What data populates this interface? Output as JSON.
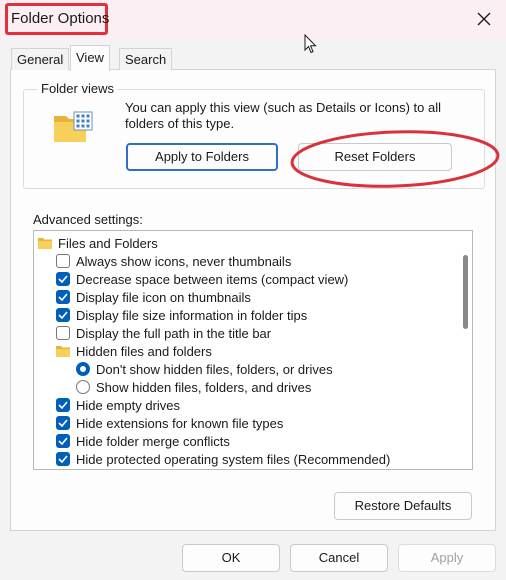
{
  "window": {
    "title": "Folder Options"
  },
  "tabs": [
    {
      "label": "General",
      "active": false
    },
    {
      "label": "View",
      "active": true
    },
    {
      "label": "Search",
      "active": false
    }
  ],
  "folder_views": {
    "heading": "Folder views",
    "description": "You can apply this view (such as Details or Icons) to all folders of this type.",
    "apply_button_label": "Apply to Folders",
    "reset_button_label": "Reset Folders"
  },
  "advanced": {
    "label": "Advanced settings:",
    "items": [
      {
        "kind": "folder",
        "indent": 0,
        "label": "Files and Folders"
      },
      {
        "kind": "checkbox",
        "indent": 1,
        "label": "Always show icons, never thumbnails",
        "checked": false
      },
      {
        "kind": "checkbox",
        "indent": 1,
        "label": "Decrease space between items (compact view)",
        "checked": true
      },
      {
        "kind": "checkbox",
        "indent": 1,
        "label": "Display file icon on thumbnails",
        "checked": true
      },
      {
        "kind": "checkbox",
        "indent": 1,
        "label": "Display file size information in folder tips",
        "checked": true
      },
      {
        "kind": "checkbox",
        "indent": 1,
        "label": "Display the full path in the title bar",
        "checked": false
      },
      {
        "kind": "folder",
        "indent": 1,
        "label": "Hidden files and folders"
      },
      {
        "kind": "radio",
        "indent": 2,
        "label": "Don't show hidden files, folders, or drives",
        "checked": true
      },
      {
        "kind": "radio",
        "indent": 2,
        "label": "Show hidden files, folders, and drives",
        "checked": false
      },
      {
        "kind": "checkbox",
        "indent": 1,
        "label": "Hide empty drives",
        "checked": true
      },
      {
        "kind": "checkbox",
        "indent": 1,
        "label": "Hide extensions for known file types",
        "checked": true
      },
      {
        "kind": "checkbox",
        "indent": 1,
        "label": "Hide folder merge conflicts",
        "checked": true
      },
      {
        "kind": "checkbox",
        "indent": 1,
        "label": "Hide protected operating system files (Recommended)",
        "checked": true
      }
    ]
  },
  "buttons": {
    "restore_defaults": "Restore Defaults",
    "ok": "OK",
    "cancel": "Cancel",
    "apply": "Apply"
  },
  "colors": {
    "accent": "#005fb8",
    "annotation_red": "#d9323a",
    "disabled_text": "#a0a0a0"
  }
}
